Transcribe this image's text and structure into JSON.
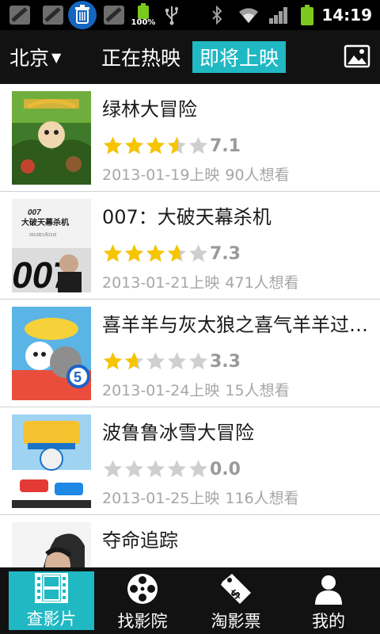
{
  "status_bar": {
    "time": "14:19",
    "battery_label": "100%",
    "icons": [
      "notification-icon",
      "notification-icon",
      "trash-icon",
      "notification-icon",
      "battery-full-icon",
      "usb-icon",
      "bluetooth-icon",
      "wifi-icon",
      "signal-icon",
      "battery-icon"
    ]
  },
  "header": {
    "city": "北京",
    "city_arrow": "▼",
    "tabs": [
      {
        "label": "正在热映",
        "active": false
      },
      {
        "label": "即将上映",
        "active": true
      }
    ],
    "gallery_icon": "image-icon"
  },
  "movies": [
    {
      "title": "绿林大冒险",
      "rating": 7.1,
      "score_text": "7.1",
      "release": "2013-01-19上映",
      "wanted": "90人想看"
    },
    {
      "title": "007：大破天幕杀机",
      "rating": 7.3,
      "score_text": "7.3",
      "release": "2013-01-21上映",
      "wanted": "471人想看"
    },
    {
      "title": "喜羊羊与灰太狼之喜气羊羊过…",
      "rating": 3.3,
      "score_text": "3.3",
      "release": "2013-01-24上映",
      "wanted": "15人想看"
    },
    {
      "title": "波鲁鲁冰雪大冒险",
      "rating": 0.0,
      "score_text": "0.0",
      "release": "2013-01-25上映",
      "wanted": "116人想看"
    },
    {
      "title": "夺命追踪",
      "rating": null,
      "score_text": "",
      "release": "",
      "wanted": ""
    }
  ],
  "bottom_nav": [
    {
      "label": "查影片",
      "icon": "film-strip-icon",
      "active": true
    },
    {
      "label": "找影院",
      "icon": "film-reel-icon",
      "active": false
    },
    {
      "label": "淘影票",
      "icon": "ticket-tag-icon",
      "active": false
    },
    {
      "label": "我的",
      "icon": "user-icon",
      "active": false
    }
  ],
  "colors": {
    "accent": "#1fb8c3",
    "bar_bg": "#121212",
    "star_on": "#f7c400",
    "star_off": "#cfcfcf",
    "text_gray": "#a6a6a6"
  }
}
